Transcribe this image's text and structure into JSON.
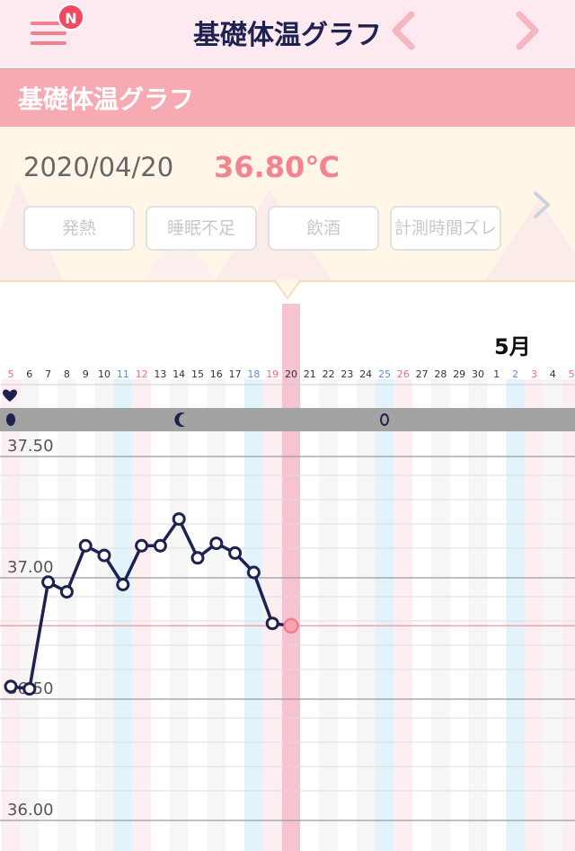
{
  "header": {
    "title": "基礎体温グラフ",
    "badge": "N"
  },
  "section": {
    "title": "基礎体温グラフ"
  },
  "record": {
    "date": "2020/04/20",
    "temperature": "36.80℃",
    "tags": [
      "発熱",
      "睡眠不足",
      "飲酒",
      "計測時間ズレ"
    ]
  },
  "icons": {
    "menu": "menu-icon",
    "prev": "chevron-left-icon",
    "next": "chevron-right-icon",
    "heart": "heart-icon",
    "moon": "crescent-moon-icon",
    "drop": "drop-icon"
  },
  "colors": {
    "accent": "#f8aab2",
    "line": "#1e2250",
    "selected": "#f6c3d0",
    "badge": "#ef4a60"
  },
  "chart_data": {
    "type": "line",
    "month_label": "5月",
    "x": [
      "5",
      "6",
      "7",
      "8",
      "9",
      "10",
      "11",
      "12",
      "13",
      "14",
      "15",
      "16",
      "17",
      "18",
      "19",
      "20",
      "21",
      "22",
      "23",
      "24",
      "25",
      "26",
      "27",
      "28",
      "29",
      "30",
      "1",
      "2",
      "3",
      "4",
      "5"
    ],
    "weekday_colors": {
      "blue": [
        "11",
        "18",
        "25",
        "2"
      ],
      "red": [
        "5",
        "12",
        "19",
        "26",
        "3"
      ]
    },
    "selected_day": "20",
    "y_ticks": [
      "37.50",
      "37.00",
      "36.50",
      "36.00"
    ],
    "ylim": [
      35.98,
      37.52
    ],
    "series": [
      {
        "x": [
          "5",
          "6",
          "7",
          "8",
          "9",
          "10",
          "11",
          "12",
          "13",
          "14",
          "15",
          "16",
          "17",
          "18",
          "19",
          "20"
        ],
        "values": [
          36.53,
          36.52,
          36.96,
          36.92,
          37.11,
          37.07,
          36.95,
          37.11,
          37.11,
          37.22,
          37.06,
          37.12,
          37.08,
          37.0,
          36.79,
          36.78
        ]
      }
    ],
    "threshold": 36.78,
    "markers": {
      "heart_days": [
        "5"
      ],
      "moon_days": [
        "14"
      ],
      "drop_days": [
        "5",
        "25"
      ]
    }
  }
}
